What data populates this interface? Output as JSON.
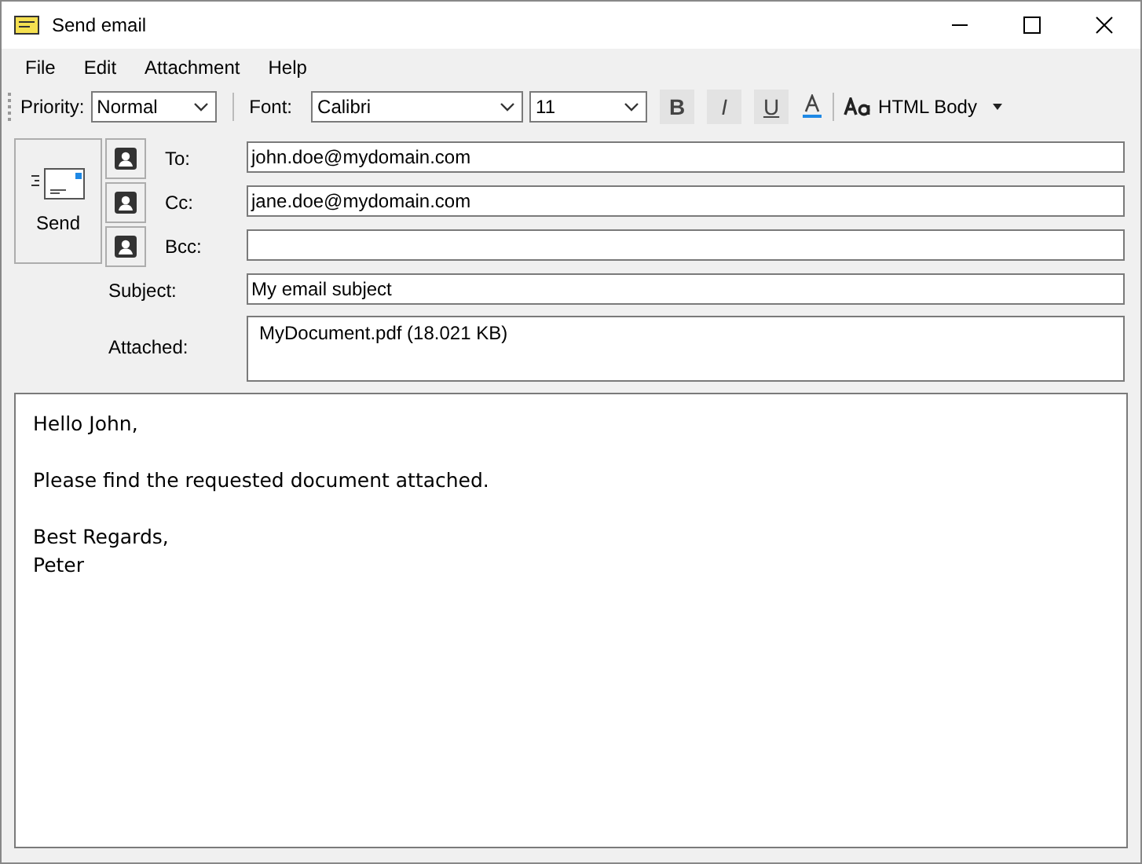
{
  "window": {
    "title": "Send email"
  },
  "menu": [
    "File",
    "Edit",
    "Attachment",
    "Help"
  ],
  "toolbar": {
    "priority_label": "Priority:",
    "priority": "Normal",
    "font_label": "Font:",
    "font": "Calibri",
    "size": "11",
    "format_buttons": [
      "B",
      "I",
      "U"
    ],
    "body_format": "HTML Body"
  },
  "send_button": "Send",
  "recipients": [
    {
      "label": "To:",
      "value": "john.doe@mydomain.com"
    },
    {
      "label": "Cc:",
      "value": "jane.doe@mydomain.com"
    },
    {
      "label": "Bcc:"
    }
  ],
  "subject": {
    "label": "Subject:",
    "value": "My email subject"
  },
  "attached": {
    "label": "Attached:",
    "files": [
      "MyDocument.pdf (18.021 KB)"
    ]
  },
  "body": {
    "paragraphs": [
      [
        "Hello John,"
      ],
      [
        "Please find the requested document attached."
      ],
      [
        "Best Regards,",
        "Peter"
      ]
    ]
  }
}
